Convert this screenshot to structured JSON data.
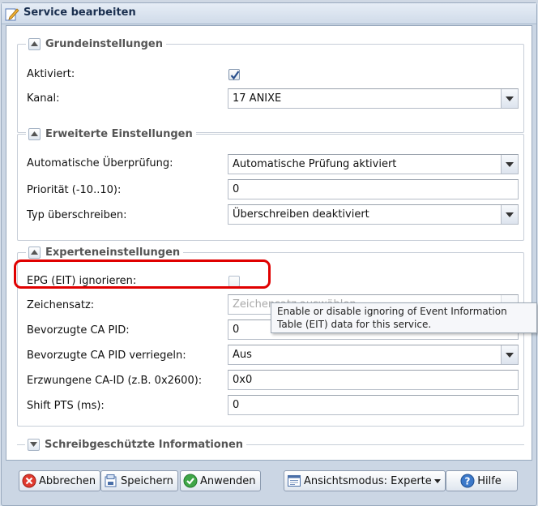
{
  "window": {
    "title": "Service bearbeiten"
  },
  "colors": {
    "highlight": "#e00000",
    "check": "#2a4f8c",
    "accent": "#1a2f4f"
  },
  "sections": {
    "basic": {
      "title": "Grundeinstellungen",
      "enabled_label": "Aktiviert:",
      "channel_label": "Kanal:",
      "channel_value": "17 ANIXE"
    },
    "advanced": {
      "title": "Erweiterte Einstellungen",
      "autocheck_label": "Automatische Überprüfung:",
      "autocheck_value": "Automatische Prüfung aktiviert",
      "priority_label": "Priorität (-10..10):",
      "priority_value": "0",
      "typeoverride_label": "Typ überschreiben:",
      "typeoverride_value": "Überschreiben deaktiviert"
    },
    "expert": {
      "title": "Experteneinstellungen",
      "epg_label": "EPG (EIT) ignorieren:",
      "charset_label": "Zeichensatz:",
      "charset_placeholder": "Zeichensatz auswählen",
      "capid_label": "Bevorzugte CA PID:",
      "capid_value": "0",
      "capidlock_label": "Bevorzugte CA PID verriegeln:",
      "capidlock_value": "Aus",
      "forcecaid_label": "Erzwungene CA-ID (z.B. 0x2600):",
      "forcecaid_value": "0x0",
      "shiftpts_label": "Shift PTS (ms):",
      "shiftpts_value": "0"
    },
    "readonly": {
      "title": "Schreibgeschützte Informationen"
    }
  },
  "tooltip": {
    "text": "Enable or disable ignoring of Event Information Table (EIT) data for this service."
  },
  "buttons": {
    "cancel": "Abbrechen",
    "save": "Speichern",
    "apply": "Anwenden",
    "viewmode": "Ansichtsmodus: Experte",
    "help": "Hilfe"
  }
}
